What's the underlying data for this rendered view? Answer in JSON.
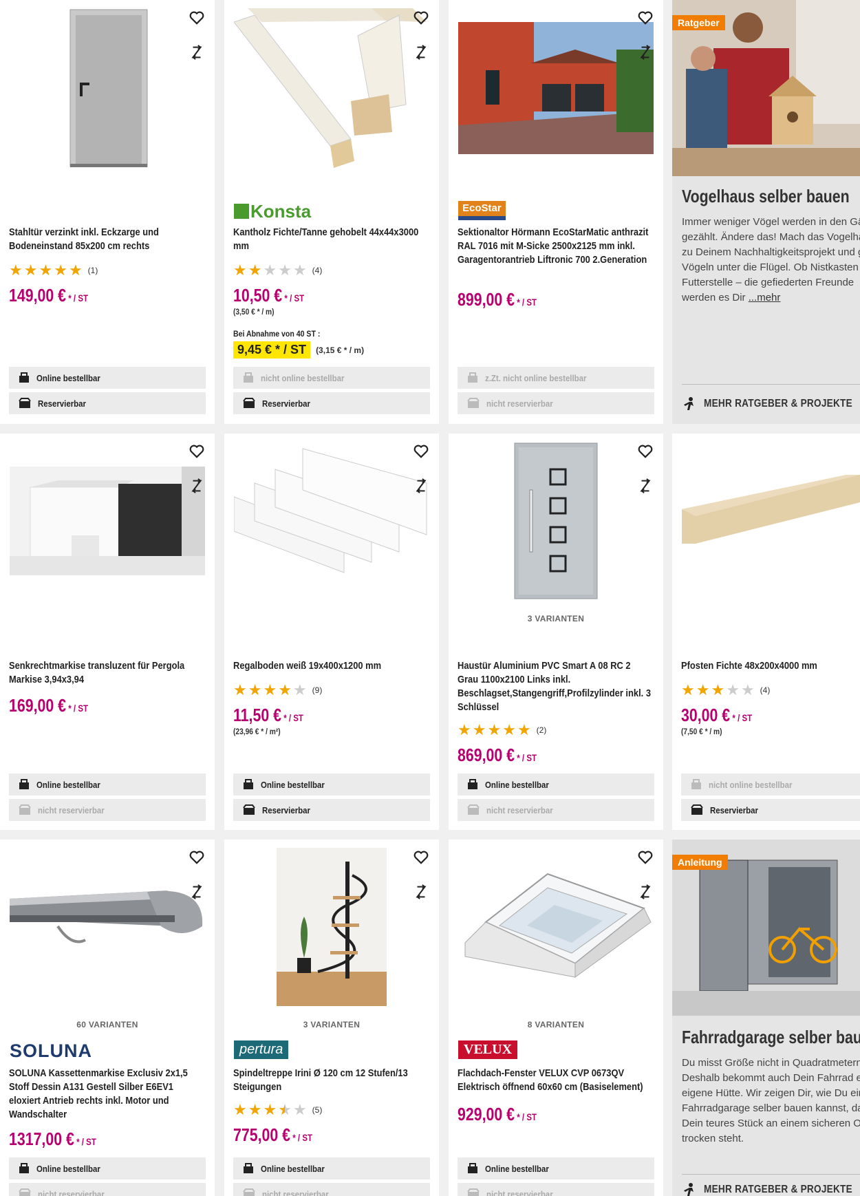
{
  "colors": {
    "accent": "#b7006e",
    "star": "#f0a500",
    "tag": "#f07d00",
    "bulk_bg": "#ffe600"
  },
  "labels": {
    "online": "Online bestellbar",
    "not_online": "nicht online bestellbar",
    "temp_not_online": "z.Zt. nicht online bestellbar",
    "reservable": "Reservierbar",
    "not_reservable": "nicht reservierbar"
  },
  "products": [
    {
      "title": "Stahltür verzinkt inkl. Eckzarge und Bodeneinstand 85x200 cm rechts",
      "rating": 5,
      "rating_count": "(1)",
      "price": "149,00 €",
      "unit": "* / ST",
      "online": "Online bestellbar",
      "reserve": "Reservierbar",
      "icon": "steel-door"
    },
    {
      "title": "Kantholz Fichte/Tanne gehobelt 44x44x3000 mm",
      "brand": "Konsta",
      "rating": 2,
      "rating_count": "(4)",
      "price": "10,50 €",
      "unit": "* / ST",
      "sub": "(3,50 € * / m)",
      "bulk_label": "Bei Abnahme von 40 ST :",
      "bulk_price": "9,45 € * / ST",
      "bulk_sub": "(3,15 € * / m)",
      "online": "nicht online bestellbar",
      "reserve": "Reservierbar",
      "icon": "timber"
    },
    {
      "title": "Sektionaltor Hörmann EcoStarMatic anthrazit RAL 7016 mit M-Sicke 2500x2125 mm inkl. Garagentorantrieb Liftronic 700 2.Generation",
      "brand": "EcoStar",
      "price": "899,00 €",
      "unit": "* / ST",
      "online": "z.Zt. nicht online bestellbar",
      "reserve": "nicht reservierbar",
      "icon": "garage"
    },
    {
      "title": "Senkrechtmarkise transluzent für Pergola Markise 3,94x3,94",
      "price": "169,00 €",
      "unit": "* / ST",
      "online": "Online bestellbar",
      "reserve": "nicht reservierbar",
      "icon": "pergola"
    },
    {
      "title": "Regalboden weiß 19x400x1200 mm",
      "rating": 4,
      "rating_count": "(9)",
      "price": "11,50 €",
      "unit": "* / ST",
      "sub": "(23,96 € * / m²)",
      "online": "Online bestellbar",
      "reserve": "Reservierbar",
      "icon": "shelves"
    },
    {
      "title": "Haustür Aluminium PVC Smart A 08 RC 2 Grau 1100x2100 Links inkl. Beschlagset,Stangengriff,Profilzylinder inkl. 3 Schlüssel",
      "variants": "3 VARIANTEN",
      "rating": 5,
      "rating_count": "(2)",
      "price": "869,00 €",
      "unit": "* / ST",
      "online": "Online bestellbar",
      "reserve": "nicht reservierbar",
      "icon": "front-door"
    },
    {
      "title": "Pfosten Fichte 48x200x4000 mm",
      "rating": 3,
      "rating_count": "(4)",
      "price": "30,00 €",
      "unit": "* / ST",
      "sub": "(7,50 € * / m)",
      "online": "nicht online bestellbar",
      "reserve": "Reservierbar",
      "icon": "plank"
    },
    {
      "title": "SOLUNA Kassettenmarkise Exclusiv 2x1,5 Stoff Dessin A131 Gestell Silber E6EV1 eloxiert Antrieb rechts inkl. Motor und Wandschalter",
      "brand": "SOLUNA",
      "variants": "60 VARIANTEN",
      "price": "1317,00 €",
      "unit": "* / ST",
      "online": "Online bestellbar",
      "reserve": "nicht reservierbar",
      "icon": "awning"
    },
    {
      "title": "Spindeltreppe Irini Ø 120 cm 12 Stufen/13 Steigungen",
      "brand": "pertura",
      "variants": "3 VARIANTEN",
      "rating": 3.5,
      "rating_count": "(5)",
      "price": "775,00 €",
      "unit": "* / ST",
      "online": "Online bestellbar",
      "reserve": "nicht reservierbar",
      "icon": "spiral-stair"
    },
    {
      "title": "Flachdach-Fenster VELUX CVP 0673QV Elektrisch öffnend 60x60 cm (Basiselement)",
      "brand": "VELUX",
      "variants": "8 VARIANTEN",
      "price": "929,00 €",
      "unit": "* / ST",
      "online": "Online bestellbar",
      "reserve": "nicht reservierbar",
      "icon": "roof-window"
    }
  ],
  "guides": [
    {
      "tag": "Ratgeber",
      "title": "Vogelhaus selber bauen",
      "text": "Immer weniger Vögel werden in den Gärten gezählt. Ändere das! Mach das Vogelhaus zu Deinem Nachhaltigkeitsprojekt und greif Vögeln unter die Flügel. Ob Nistkasten oder Futterstelle – die gefiederten Freunde werden es Dir",
      "more_link": "...mehr",
      "cta": "MEHR RATGEBER & PROJEKTE"
    },
    {
      "tag": "Anleitung",
      "title": "Fahrradgarage selber bauen",
      "text": "Du misst Größe nicht in Quadratmetern? Deshalb bekommt auch Dein Fahrrad eine eigene Hütte. Wir zeigen Dir, wie Du eine Fahrradgarage selber bauen kannst, damit Dein teures Stück an einem sicheren Ort und trocken steht.",
      "cta": "MEHR RATGEBER & PROJEKTE"
    }
  ]
}
